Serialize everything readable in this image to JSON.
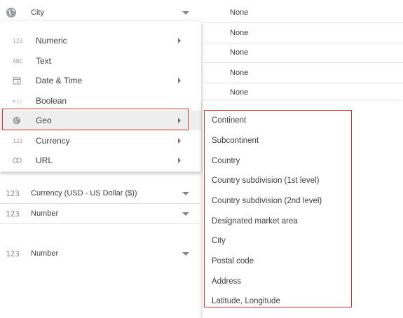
{
  "fields": [
    {
      "icon": "globe-icon",
      "type": "City"
    },
    {
      "icon": "123",
      "type": "Currency (USD - US Dollar ($))"
    },
    {
      "icon": "123",
      "type": "Number"
    },
    {
      "icon": "123",
      "type": "Number"
    }
  ],
  "aggregations": [
    "None",
    "None",
    "None",
    "None",
    "None"
  ],
  "menu": {
    "items": [
      {
        "icon": "123",
        "label": "Numeric",
        "has_submenu": true
      },
      {
        "icon": "ABC",
        "label": "Text",
        "has_submenu": false
      },
      {
        "icon": "calendar-icon",
        "label": "Date & Time",
        "has_submenu": true
      },
      {
        "icon": "×|✓",
        "label": "Boolean",
        "has_submenu": false
      },
      {
        "icon": "globe-icon",
        "label": "Geo",
        "has_submenu": true,
        "selected": true
      },
      {
        "icon": "123",
        "label": "Currency",
        "has_submenu": true
      },
      {
        "icon": "link-icon",
        "label": "URL",
        "has_submenu": true
      }
    ]
  },
  "geo_submenu": {
    "items": [
      "Continent",
      "Subcontinent",
      "Country",
      "Country subdivision (1st level)",
      "Country subdivision (2nd level)",
      "Designated market area",
      "City",
      "Postal code",
      "Address",
      "Latitude, Longitude"
    ]
  },
  "colors": {
    "highlight_outline": "#d32f2f",
    "selected_bg": "#eeeeee"
  }
}
